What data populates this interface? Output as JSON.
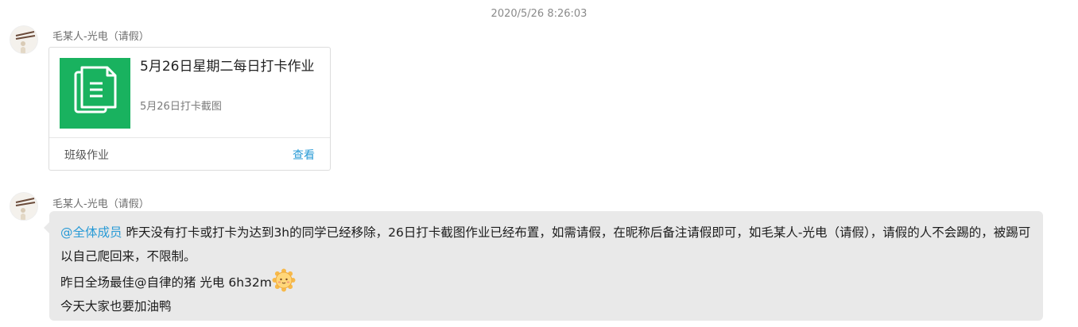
{
  "timestamp": "2020/5/26 8:26:03",
  "messages": [
    {
      "sender": "毛某人-光电（请假）",
      "card": {
        "title": "5月26日星期二每日打卡作业",
        "subtitle": "5月26日打卡截图",
        "footer_label": "班级作业",
        "action_label": "查看",
        "icon": "document-icon",
        "icon_color": "#19b25f"
      }
    },
    {
      "sender": "毛某人-光电（请假）",
      "mention": "@全体成员",
      "text_line1": " 昨天没有打卡或打卡为达到3h的同学已经移除，26日打卡截图作业已经布置，如需请假，在昵称后备注请假即可，如毛某人-光电（请假），请假的人不会踢的，被踢可以自己爬回来，不限制。",
      "text_line2": "昨日全场最佳@自律的猪 光电 6h32m",
      "emoji": "sun-face-emoji",
      "text_line3": "今天大家也要加油鸭"
    }
  ],
  "colors": {
    "link": "#2a9bd6",
    "bubble_bg": "#e9e9e9"
  }
}
